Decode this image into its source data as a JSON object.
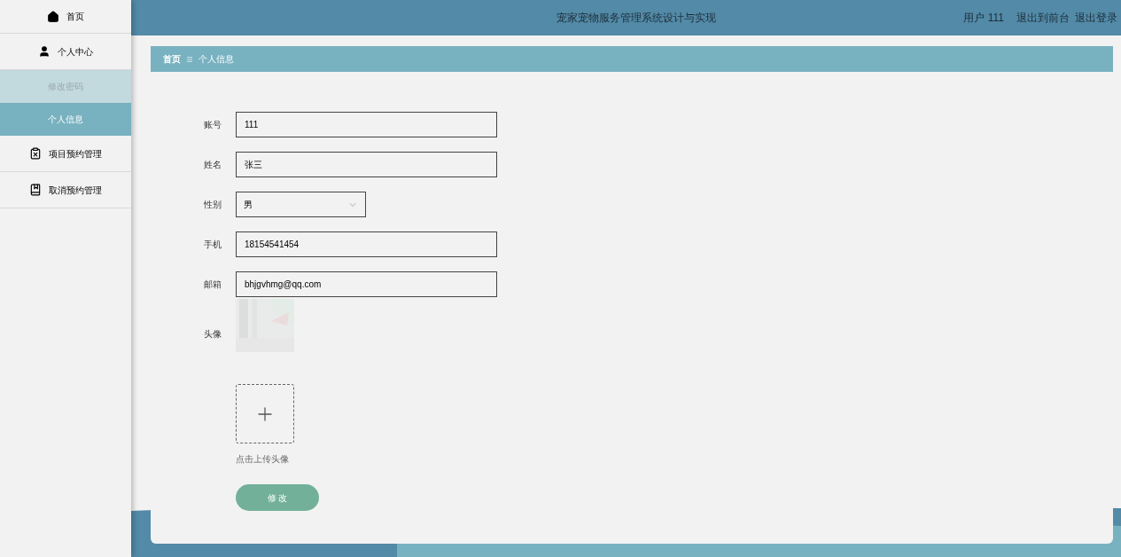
{
  "sidebar": {
    "items": [
      {
        "label": "首页",
        "selected": false
      },
      {
        "label": "个人中心",
        "selected": false,
        "children": [
          {
            "label": "修改密码",
            "selected": false
          },
          {
            "label": "个人信息",
            "selected": true
          }
        ]
      },
      {
        "label": "项目预约管理",
        "selected": false
      },
      {
        "label": "取消预约管理",
        "selected": false
      }
    ]
  },
  "header": {
    "title": "宠家宠物服务管理系统设计与实现",
    "user": "用户 111",
    "links": [
      "退出到前台",
      "退出登录"
    ]
  },
  "breadcrumb": [
    "首页",
    "个人信息"
  ],
  "form": {
    "fields": [
      {
        "kind": "text",
        "label": "账号",
        "value": "111"
      },
      {
        "kind": "text",
        "label": "姓名",
        "value": "张三"
      },
      {
        "kind": "select",
        "label": "性别",
        "value": "男"
      },
      {
        "kind": "text",
        "label": "手机",
        "value": "18154541454"
      },
      {
        "kind": "text",
        "label": "邮箱",
        "value": "bhjgvhmg@qq.com"
      },
      {
        "label": "头像"
      }
    ],
    "upload_hint": "点击上传头像",
    "submit": "修 改"
  }
}
